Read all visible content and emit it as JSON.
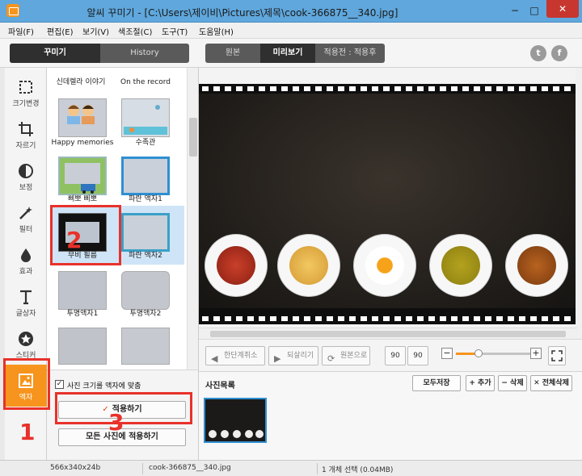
{
  "window": {
    "title": "알씨 꾸미기 - [C:\\Users\\제이비\\Pictures\\제목\\cook-366875__340.jpg]",
    "min": "−",
    "max": "□",
    "close": "✕"
  },
  "menu": [
    "파일(F)",
    "편집(E)",
    "보기(V)",
    "색조절(C)",
    "도구(T)",
    "도움말(H)"
  ],
  "left_tabs": {
    "decorate": "꾸미기",
    "history": "History"
  },
  "view_tabs": {
    "original": "원본",
    "preview": "미리보기",
    "before_after": "적용전 : 적용후"
  },
  "social": {
    "twitter": "t",
    "facebook": "f"
  },
  "tools": [
    {
      "label": "크기변경",
      "icon": "resize-icon"
    },
    {
      "label": "자르기",
      "icon": "crop-icon"
    },
    {
      "label": "보정",
      "icon": "adjust-icon"
    },
    {
      "label": "필터",
      "icon": "filter-wand-icon"
    },
    {
      "label": "효과",
      "icon": "effect-drop-icon"
    },
    {
      "label": "글상자",
      "icon": "text-icon"
    },
    {
      "label": "스티커",
      "icon": "sticker-star-icon"
    },
    {
      "label": "액자",
      "icon": "frame-icon",
      "active": true
    }
  ],
  "frames": {
    "top_labels": [
      "신데렐라 이야기",
      "On the record"
    ],
    "row1": [
      "Happy memories",
      "수족관"
    ],
    "row2": [
      "삐뽀 삐뽀",
      "파란 액자1"
    ],
    "row3": [
      "무비 필름",
      "파란 액자2"
    ],
    "row4": [
      "투명액자1",
      "투명액자2"
    ]
  },
  "apply": {
    "fit_checkbox": "사진 크기를 액자에 맞춤",
    "check_mark": "✓",
    "apply_button": "적용하기",
    "apply_all_button": "모든 사진에 적용하기"
  },
  "edit_toolbar": {
    "undo": "한단계취소",
    "redo": "되살리기",
    "restore": "원본으로",
    "rotate_left": "90",
    "rotate_right": "90",
    "zoom_out": "−",
    "zoom_in": "+",
    "zoom_level": 0.3
  },
  "photo_list": {
    "title": "사진목록",
    "save_all": "모두저장",
    "add": "+ 추가",
    "delete": "− 삭제",
    "delete_all": "✕ 전체삭제"
  },
  "status": {
    "size": "566x340x24b",
    "filename": "cook-366875__340.jpg",
    "selection": "1 개체 선택 (0.04MB)"
  },
  "annotations": {
    "one": "1",
    "two": "2",
    "three": "3"
  },
  "colors": {
    "accent": "#f7941d",
    "selection_blue": "#2e8fd2",
    "annotation_red": "#e8312a"
  }
}
